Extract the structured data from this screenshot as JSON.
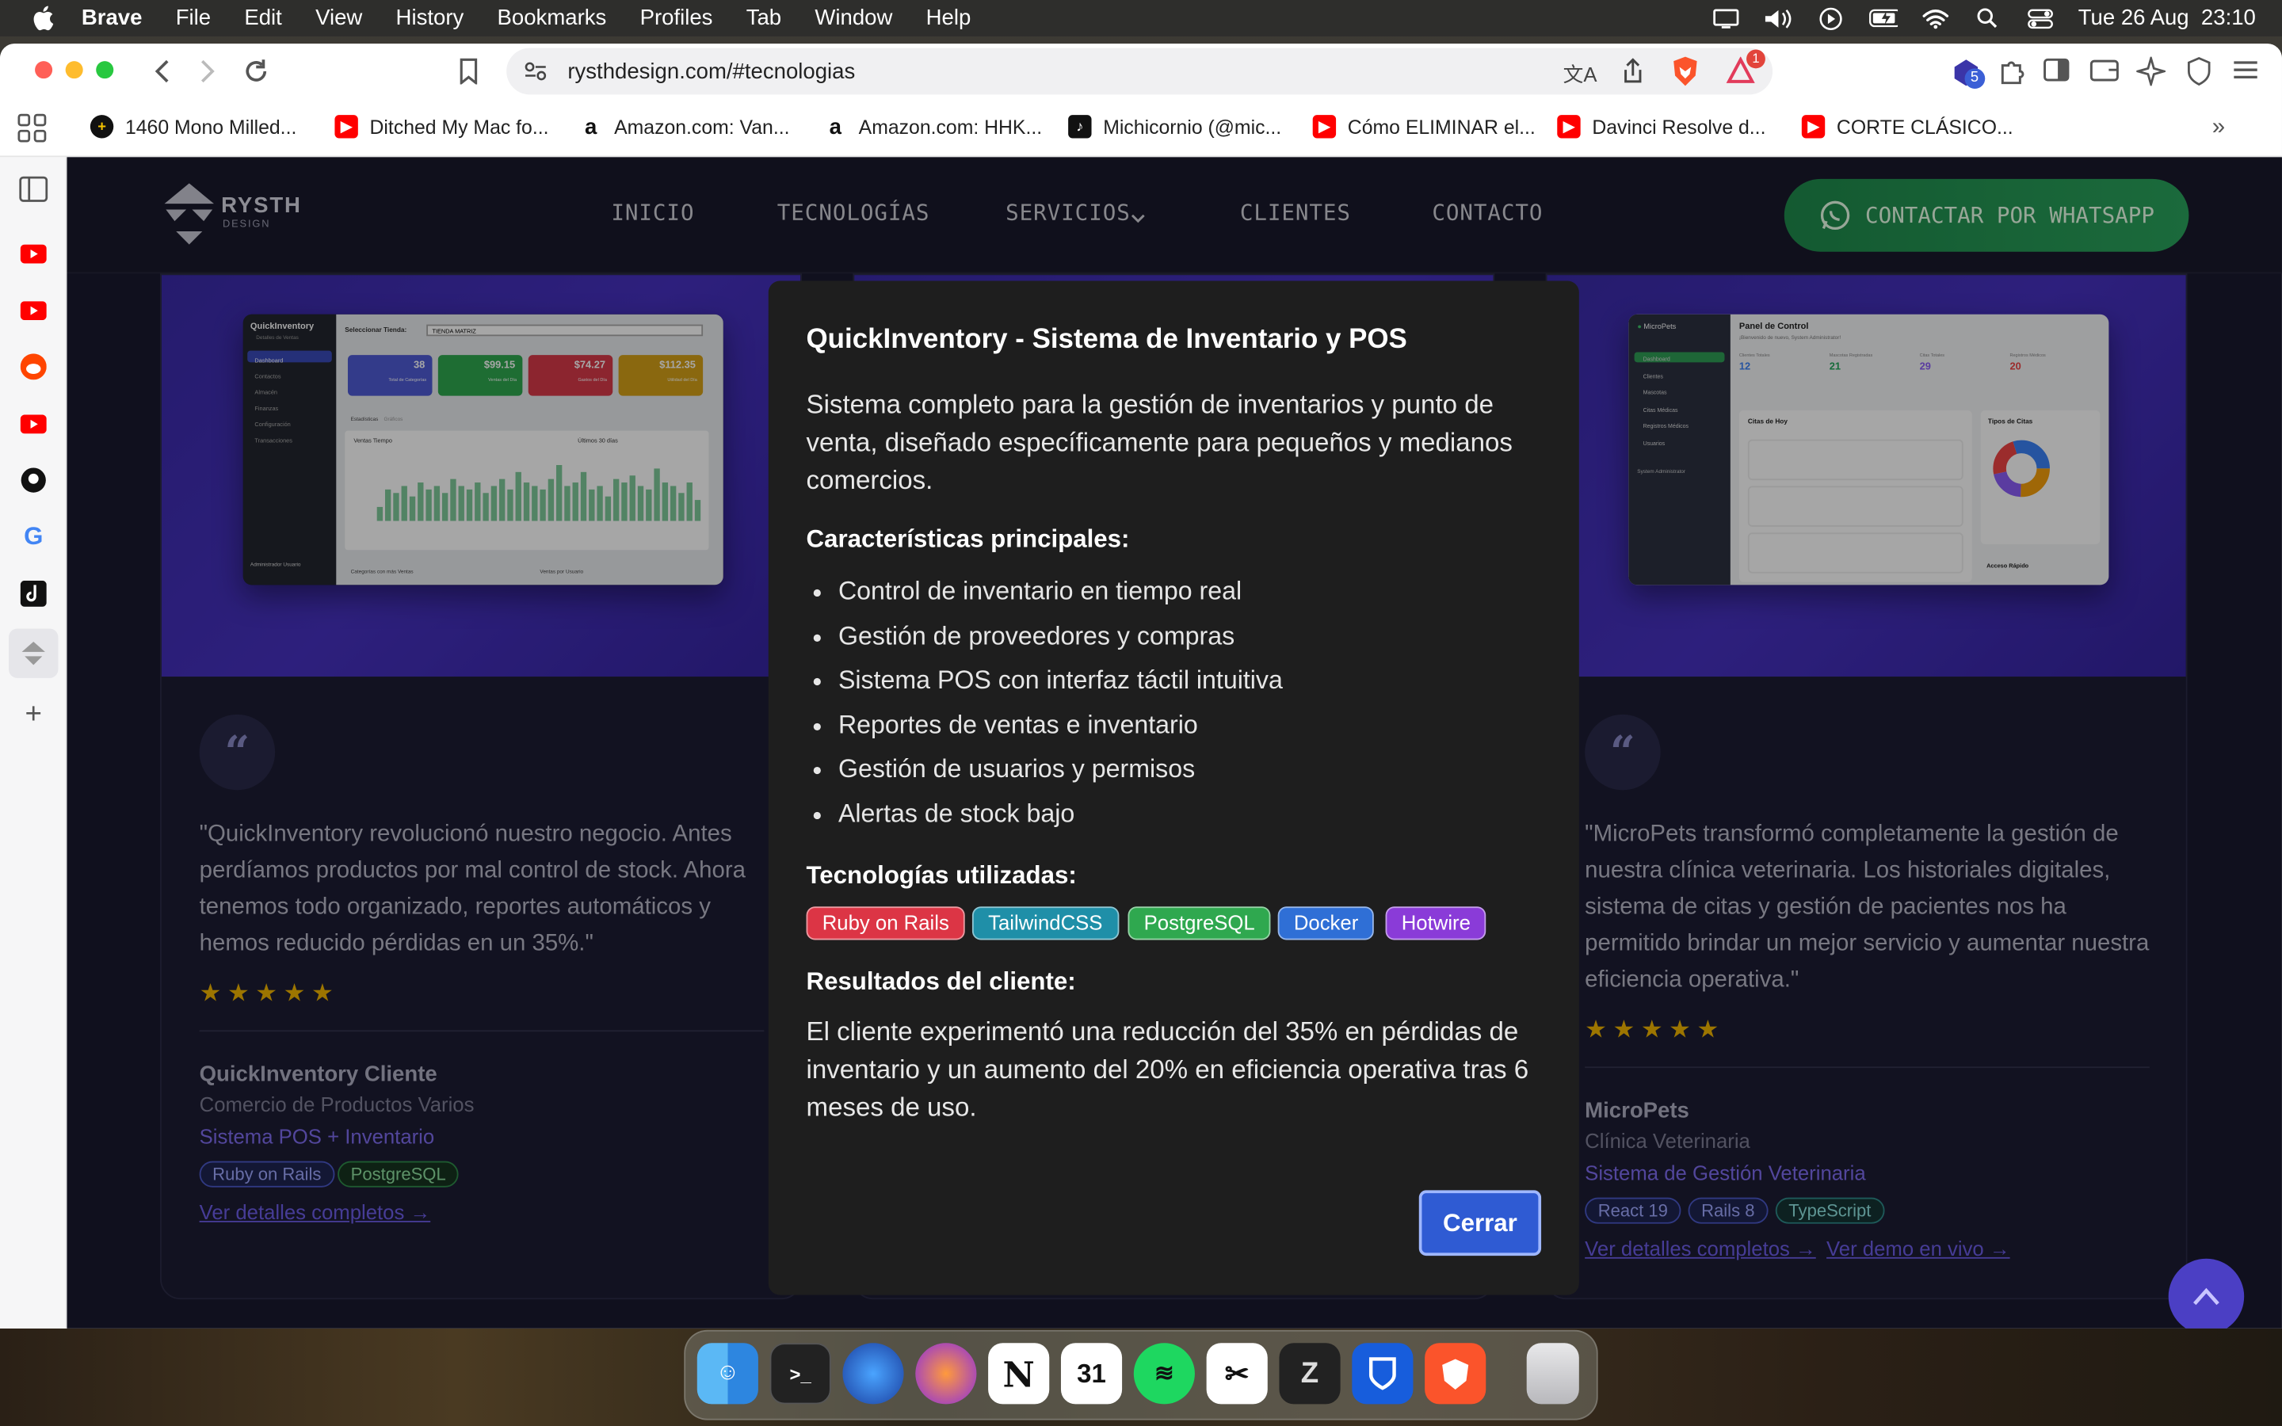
{
  "menubar": {
    "app": "Brave",
    "items": [
      "File",
      "Edit",
      "View",
      "History",
      "Bookmarks",
      "Profiles",
      "Tab",
      "Window",
      "Help"
    ],
    "clock": "Tue 26 Aug  23:10"
  },
  "browser": {
    "url": "rysthdesign.com/#tecnologias",
    "rewards_badge": "1",
    "extension_badge": "5",
    "bookmarks": [
      {
        "label": "1460 Mono Milled...",
        "icon": "plus-circle-icon",
        "color": "#111111"
      },
      {
        "label": "Ditched My Mac fo...",
        "icon": "youtube-icon",
        "color": "#ff0000"
      },
      {
        "label": "Amazon.com: Van...",
        "icon": "amazon-icon",
        "color": "#111111"
      },
      {
        "label": "Amazon.com: HHK...",
        "icon": "amazon-icon",
        "color": "#111111"
      },
      {
        "label": "Michicornio (@mic...",
        "icon": "tiktok-icon",
        "color": "#111111"
      },
      {
        "label": "Cómo ELIMINAR el...",
        "icon": "youtube-icon",
        "color": "#ff0000"
      },
      {
        "label": "Davinci Resolve d...",
        "icon": "youtube-icon",
        "color": "#ff0000"
      },
      {
        "label": "CORTE CLÁSICO...",
        "icon": "youtube-icon",
        "color": "#ff0000"
      }
    ],
    "sidebar_icons": [
      "sidebar-toggle-icon",
      "youtube-icon",
      "youtube-icon",
      "reddit-icon",
      "youtube-icon",
      "github-icon",
      "google-icon",
      "tiktok-icon",
      "rysth-icon",
      "add-icon"
    ]
  },
  "site": {
    "logo_text": "RYSTH",
    "logo_sub": "DESIGN",
    "nav": [
      "INICIO",
      "TECNOLOGÍAS",
      "SERVICIOS",
      "CLIENTES",
      "CONTACTO"
    ],
    "cta": "CONTACTAR POR WHATSAPP"
  },
  "cards": [
    {
      "quote_mark": "“",
      "quote": "\"QuickInventory revolucionó nuestro negocio. Antes perdíamos productos por mal control de stock. Ahora tenemos todo organizado, reportes automáticos y hemos reducido pérdidas en un 35%.\"",
      "stars": "★★★★★",
      "client": "QuickInventory Cliente",
      "industry": "Comercio de Productos Varios",
      "product": "Sistema POS + Inventario",
      "tags": [
        "Ruby on Rails",
        "PostgreSQL"
      ],
      "link1": "Ver detalles completos →",
      "shot": {
        "brand": "QuickInventory",
        "brand_sub": "Detalles de Ventas",
        "store_label": "Seleccionar Tienda:",
        "store_value": "TIENDA MATRIZ",
        "stats": [
          "38",
          "$99.15",
          "$74.27",
          "$112.35"
        ],
        "stat_labels": [
          "Total de Categorías",
          "Ventas del Día",
          "Gastos del Día",
          "Utilidad del Día"
        ],
        "chart_title": "Ventas Tiempo",
        "chart_range": "Últimos 30 días",
        "tabs": [
          "Estadísticas",
          "Gráficos"
        ],
        "bottom_left": "Categorías con más Ventas",
        "bottom_right": "Ventas por Usuario",
        "menu": [
          "Dashboard",
          "Contactos",
          "Almacén",
          "Finanzas",
          "Configuración",
          "Transacciones"
        ],
        "user": "Administrador Usuario",
        "bar_levels": [
          0.2,
          0.45,
          0.4,
          0.5,
          0.35,
          0.55,
          0.45,
          0.5,
          0.4,
          0.6,
          0.5,
          0.45,
          0.55,
          0.4,
          0.5,
          0.6,
          0.45,
          0.7,
          0.55,
          0.5,
          0.45,
          0.6,
          0.8,
          0.5,
          0.55,
          0.7,
          0.45,
          0.5,
          0.35,
          0.6,
          0.55,
          0.65,
          0.5,
          0.45,
          0.75,
          0.55,
          0.5,
          0.4,
          0.55,
          0.3
        ]
      }
    },
    {
      "quote_mark": "“",
      "quote": "\"MicroPets transformó completamente la gestión de nuestra clínica veterinaria. Los historiales digitales, sistema de citas y gestión de pacientes nos ha permitido brindar un mejor servicio y aumentar nuestra eficiencia operativa.\"",
      "stars": "★★★★★",
      "client": "MicroPets",
      "industry": "Clínica Veterinaria",
      "product": "Sistema de Gestión Veterinaria",
      "tags": [
        "React 19",
        "Rails 8",
        "TypeScript"
      ],
      "link1": "Ver detalles completos →",
      "link2": "Ver demo en vivo →",
      "shot": {
        "brand": "MicroPets",
        "title": "Panel de Control",
        "subtitle": "¡Bienvenido de nuevo, System Administrator!",
        "stats": [
          "12",
          "21",
          "29",
          "20"
        ],
        "stat_labels": [
          "Clientes Totales",
          "Mascotas Registradas",
          "Citas Totales",
          "Registros Médicos"
        ],
        "citas_title": "Citas de Hoy",
        "tipos_title": "Tipos de Citas",
        "acceso": "Acceso Rápido",
        "menu": [
          "Dashboard",
          "Clientes",
          "Mascotas",
          "Citas Médicas",
          "Registros Médicos",
          "Usuarios"
        ],
        "user": "System Administrator"
      }
    }
  ],
  "modal": {
    "title": "QuickInventory - Sistema de Inventario y POS",
    "description": "Sistema completo para la gestión de inventarios y punto de venta, diseñado específicamente para pequeños y medianos comercios.",
    "features_title": "Características principales:",
    "features": [
      "Control de inventario en tiempo real",
      "Gestión de proveedores y compras",
      "Sistema POS con interfaz táctil intuitiva",
      "Reportes de ventas e inventario",
      "Gestión de usuarios y permisos",
      "Alertas de stock bajo"
    ],
    "tech_title": "Tecnologías utilizadas:",
    "techs": [
      {
        "label": "Ruby on Rails",
        "color": "#dc3545"
      },
      {
        "label": "TailwindCSS",
        "color": "#1f8fa8"
      },
      {
        "label": "PostgreSQL",
        "color": "#2fa84f"
      },
      {
        "label": "Docker",
        "color": "#2f6fd6"
      },
      {
        "label": "Hotwire",
        "color": "#8a3bd8"
      }
    ],
    "results_title": "Resultados del cliente:",
    "results": "El cliente experimentó una reducción del 35% en pérdidas de inventario y un aumento del 20% en eficiencia operativa tras 6 meses de uso.",
    "close": "Cerrar"
  },
  "dock": [
    "finder-icon",
    "terminal-icon",
    "firefox-icon",
    "firefox-dev-icon",
    "notion-icon",
    "calendar-icon",
    "spotify-icon",
    "capcut-icon",
    "zed-icon",
    "bitwarden-icon",
    "brave-icon",
    "trash-icon"
  ]
}
